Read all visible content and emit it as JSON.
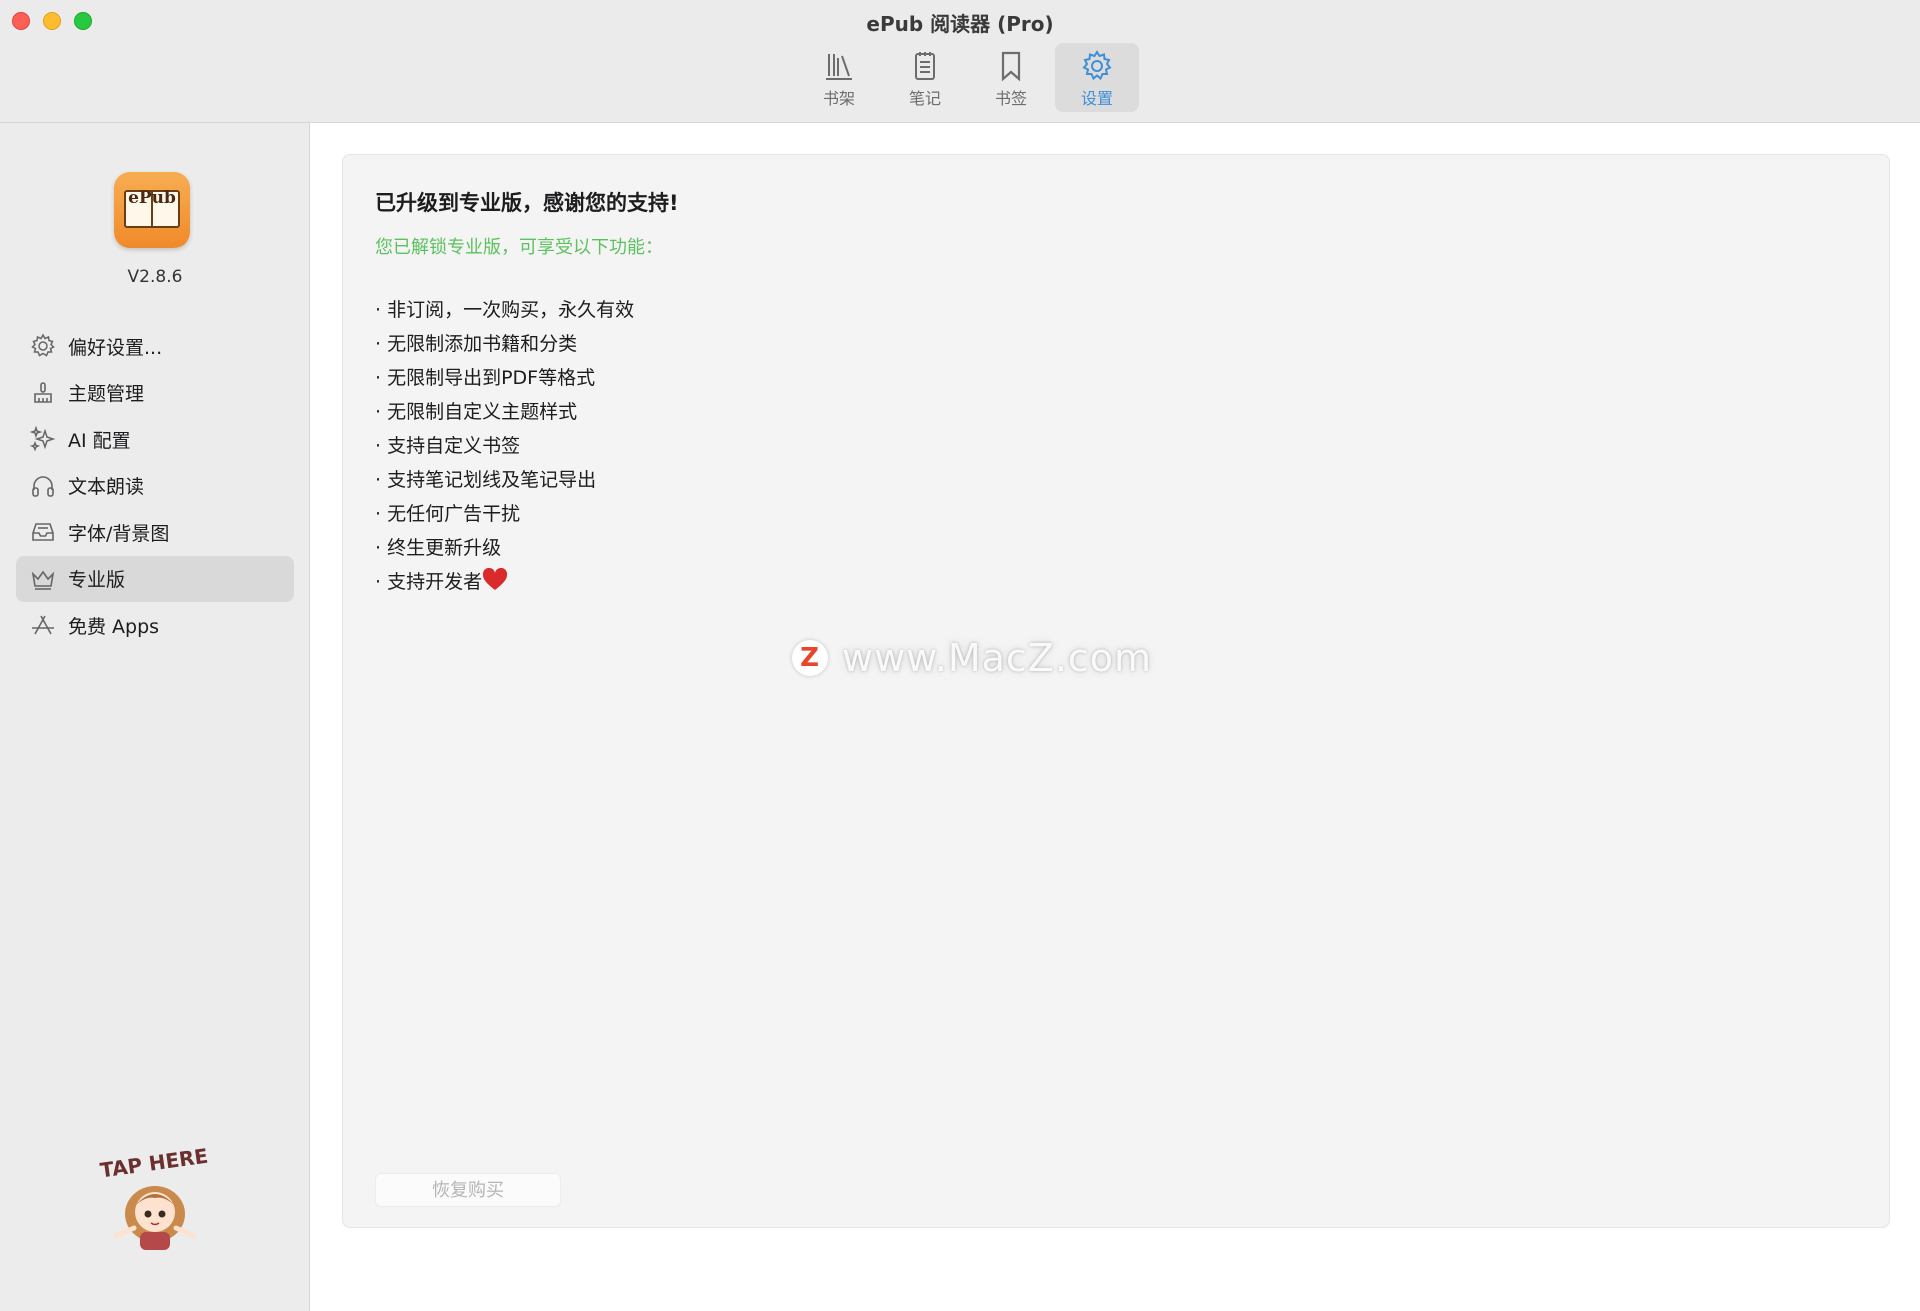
{
  "window": {
    "title": "ePub 阅读器 (Pro)"
  },
  "toolbar": {
    "items": [
      {
        "label": "书架",
        "icon": "bookshelf-icon"
      },
      {
        "label": "笔记",
        "icon": "notes-icon"
      },
      {
        "label": "书签",
        "icon": "bookmark-icon"
      },
      {
        "label": "设置",
        "icon": "gear-icon",
        "active": true
      }
    ],
    "active_color": "#3f8fd8"
  },
  "sidebar": {
    "app_icon_text": "ePub",
    "version": "V2.8.6",
    "items": [
      {
        "label": "偏好设置...",
        "icon": "gear-icon"
      },
      {
        "label": "主题管理",
        "icon": "brush-icon"
      },
      {
        "label": "AI 配置",
        "icon": "sparkles-icon"
      },
      {
        "label": "文本朗读",
        "icon": "headphones-icon"
      },
      {
        "label": "字体/背景图",
        "icon": "tray-icon"
      },
      {
        "label": "专业版",
        "icon": "crown-icon",
        "active": true
      },
      {
        "label": "免费 Apps",
        "icon": "app-store-icon"
      }
    ],
    "mascot_text": "TAP HERE"
  },
  "main": {
    "heading": "已升级到专业版，感谢您的支持!",
    "subheading": "您已解锁专业版，可享受以下功能：",
    "subheading_color": "#5cc25f",
    "features": [
      "非订阅，一次购买，永久有效",
      "无限制添加书籍和分类",
      "无限制导出到PDF等格式",
      "无限制自定义主题样式",
      "支持自定义书签",
      "支持笔记划线及笔记导出",
      "无任何广告干扰",
      "终生更新升级",
      "支持开发者"
    ],
    "restore_button": "恢复购买"
  },
  "watermark": {
    "logo": "Z",
    "text": "www.MacZ.com"
  }
}
